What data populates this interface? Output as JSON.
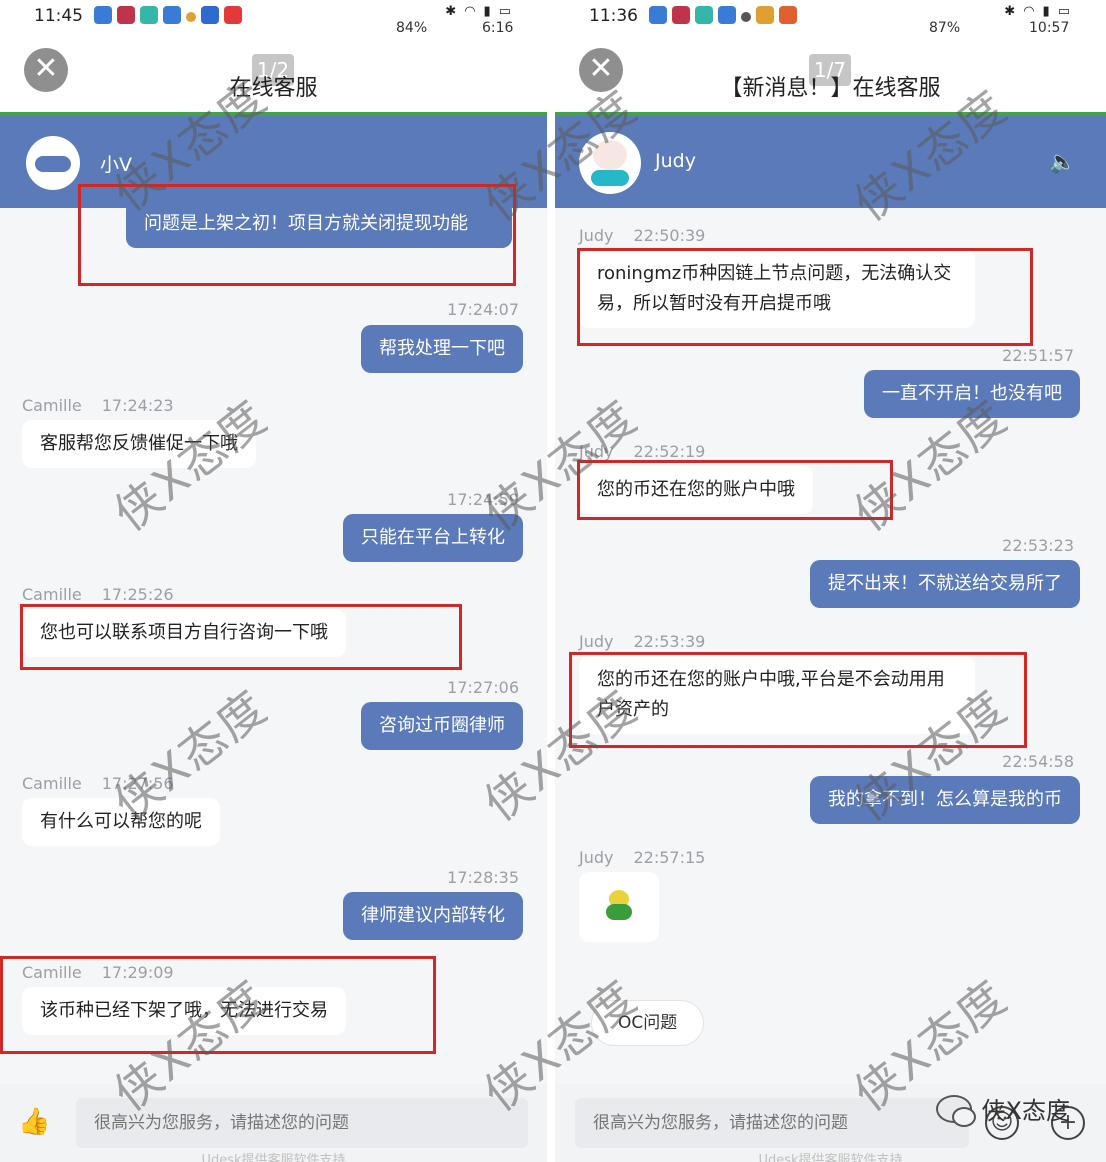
{
  "left": {
    "status": {
      "time": "11:45",
      "battery": "84%",
      "clock": "6:16"
    },
    "pager": "1/2",
    "title": "在线客服",
    "agent_name": "小V",
    "messages": [
      {
        "dir": "in",
        "text": "问题是上架之初！项目方就关闭提现功能"
      },
      {
        "dir": "out",
        "time": "17:24:07",
        "text": "帮我处理一下吧"
      },
      {
        "dir": "in",
        "sender": "Camille",
        "time": "17:24:23",
        "text": "客服帮您反馈催促一下哦"
      },
      {
        "dir": "out",
        "time": "17:24:59",
        "text": "只能在平台上转化"
      },
      {
        "dir": "in",
        "sender": "Camille",
        "time": "17:25:26",
        "text": "您也可以联系项目方自行咨询一下哦"
      },
      {
        "dir": "out",
        "time": "17:27:06",
        "text": "咨询过币圈律师"
      },
      {
        "dir": "in",
        "sender": "Camille",
        "time": "17:27:56",
        "text": "有什么可以帮您的呢"
      },
      {
        "dir": "out",
        "time": "17:28:35",
        "text": "律师建议内部转化"
      },
      {
        "dir": "in",
        "sender": "Camille",
        "time": "17:29:09",
        "text": "该币种已经下架了哦，无法进行交易"
      }
    ],
    "input_placeholder": "很高兴为您服务，请描述您的问题",
    "footer": "Udesk提供客服软件支持"
  },
  "right": {
    "status": {
      "time": "11:36",
      "battery": "87%",
      "clock": "10:57"
    },
    "pager": "1/7",
    "title": "【新消息！】在线客服",
    "agent_name": "Judy",
    "messages": [
      {
        "dir": "in",
        "sender": "Judy",
        "time": "22:50:39",
        "text": "roningmz币种因链上节点问题，无法确认交易，所以暂时没有开启提币哦"
      },
      {
        "dir": "out",
        "time": "22:51:57",
        "text": "一直不开启！也没有吧"
      },
      {
        "dir": "in",
        "sender": "Judy",
        "time": "22:52:19",
        "text": "您的币还在您的账户中哦"
      },
      {
        "dir": "out",
        "time": "22:53:23",
        "text": "提不出来！不就送给交易所了"
      },
      {
        "dir": "in",
        "sender": "Judy",
        "time": "22:53:39",
        "text": "您的币还在您的账户中哦,平台是不会动用用户资产的"
      },
      {
        "dir": "out",
        "time": "22:54:58",
        "text": "我的拿不到！怎么算是我的币"
      },
      {
        "dir": "in",
        "sender": "Judy",
        "time": "22:57:15",
        "emoji": "frog-emoji"
      }
    ],
    "quick_reply": "OC问题",
    "input_placeholder": "很高兴为您服务，请描述您的问题",
    "footer": "Udesk提供客服软件支持"
  },
  "watermark": "侠X态度",
  "brand": "侠X态度",
  "colors": {
    "accent": "#5b7ab9",
    "highlight": "#d22727",
    "green_line": "#46a24a"
  }
}
